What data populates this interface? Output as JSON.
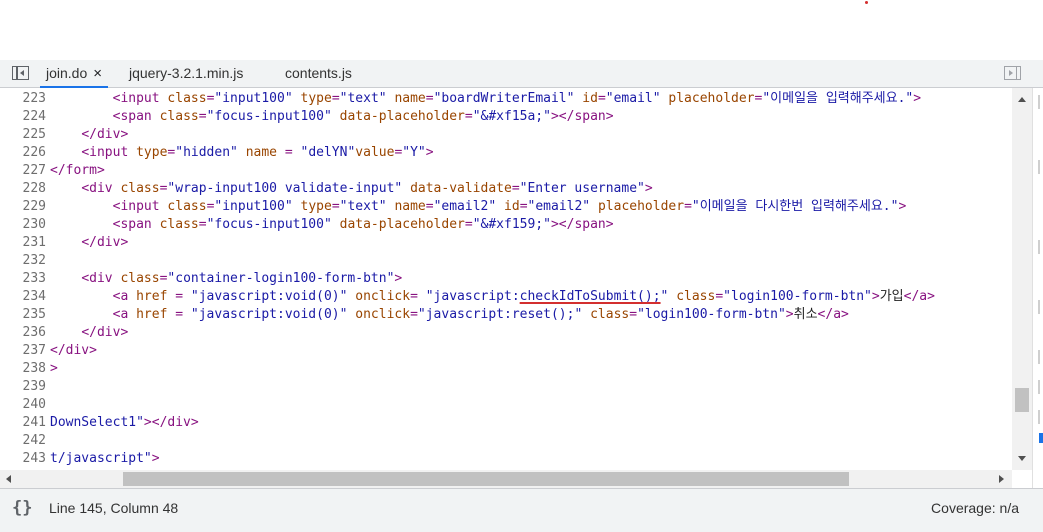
{
  "tabs": [
    {
      "label": "join.do",
      "active": true,
      "close": "×"
    },
    {
      "label": "jquery-3.2.1.min.js",
      "active": false
    },
    {
      "label": "contents.js",
      "active": false
    }
  ],
  "lines": [
    {
      "n": "223",
      "code": [
        [
          "",
          "        "
        ],
        [
          "tag",
          "<input "
        ],
        [
          "attr",
          "class"
        ],
        [
          "tag",
          "="
        ],
        [
          "val",
          "\"input100\""
        ],
        [
          "",
          " "
        ],
        [
          "attr",
          "type"
        ],
        [
          "tag",
          "="
        ],
        [
          "val",
          "\"text\""
        ],
        [
          "",
          " "
        ],
        [
          "attr",
          "name"
        ],
        [
          "tag",
          "="
        ],
        [
          "val",
          "\"boardWriterEmail\""
        ],
        [
          "",
          " "
        ],
        [
          "attr",
          "id"
        ],
        [
          "tag",
          "="
        ],
        [
          "val",
          "\"email\""
        ],
        [
          "",
          " "
        ],
        [
          "attr",
          "placeholder"
        ],
        [
          "tag",
          "="
        ],
        [
          "val",
          "\"이메일을 입력해주세요.\""
        ],
        [
          "tag",
          ">"
        ]
      ]
    },
    {
      "n": "224",
      "code": [
        [
          "",
          "        "
        ],
        [
          "tag",
          "<span "
        ],
        [
          "attr",
          "class"
        ],
        [
          "tag",
          "="
        ],
        [
          "val",
          "\"focus-input100\""
        ],
        [
          "",
          " "
        ],
        [
          "attr",
          "data-placeholder"
        ],
        [
          "tag",
          "="
        ],
        [
          "val",
          "\"&#xf15a;\""
        ],
        [
          "tag",
          "></span>"
        ]
      ]
    },
    {
      "n": "225",
      "code": [
        [
          "",
          "    "
        ],
        [
          "tag",
          "</div>"
        ]
      ]
    },
    {
      "n": "226",
      "code": [
        [
          "",
          "    "
        ],
        [
          "tag",
          "<input "
        ],
        [
          "attr",
          "type"
        ],
        [
          "tag",
          "="
        ],
        [
          "val",
          "\"hidden\""
        ],
        [
          "",
          " "
        ],
        [
          "attr",
          "name"
        ],
        [
          "tag",
          " = "
        ],
        [
          "val",
          "\"delYN\""
        ],
        [
          "attr",
          "value"
        ],
        [
          "tag",
          "="
        ],
        [
          "val",
          "\"Y\""
        ],
        [
          "tag",
          ">"
        ]
      ]
    },
    {
      "n": "227",
      "code": [
        [
          "tag",
          "</form>"
        ]
      ]
    },
    {
      "n": "228",
      "code": [
        [
          "",
          "    "
        ],
        [
          "tag",
          "<div "
        ],
        [
          "attr",
          "class"
        ],
        [
          "tag",
          "="
        ],
        [
          "val",
          "\"wrap-input100 validate-input\""
        ],
        [
          "",
          " "
        ],
        [
          "attr",
          "data-validate"
        ],
        [
          "tag",
          "="
        ],
        [
          "val",
          "\"Enter username\""
        ],
        [
          "tag",
          ">"
        ]
      ]
    },
    {
      "n": "229",
      "code": [
        [
          "",
          "        "
        ],
        [
          "tag",
          "<input "
        ],
        [
          "attr",
          "class"
        ],
        [
          "tag",
          "="
        ],
        [
          "val",
          "\"input100\""
        ],
        [
          "",
          " "
        ],
        [
          "attr",
          "type"
        ],
        [
          "tag",
          "="
        ],
        [
          "val",
          "\"text\""
        ],
        [
          "",
          " "
        ],
        [
          "attr",
          "name"
        ],
        [
          "tag",
          "="
        ],
        [
          "val",
          "\"email2\""
        ],
        [
          "",
          " "
        ],
        [
          "attr",
          "id"
        ],
        [
          "tag",
          "="
        ],
        [
          "val",
          "\"email2\""
        ],
        [
          "",
          " "
        ],
        [
          "attr",
          "placeholder"
        ],
        [
          "tag",
          "="
        ],
        [
          "val",
          "\"이메일을 다시한번 입력해주세요.\""
        ],
        [
          "tag",
          ">"
        ]
      ]
    },
    {
      "n": "230",
      "code": [
        [
          "",
          "        "
        ],
        [
          "tag",
          "<span "
        ],
        [
          "attr",
          "class"
        ],
        [
          "tag",
          "="
        ],
        [
          "val",
          "\"focus-input100\""
        ],
        [
          "",
          " "
        ],
        [
          "attr",
          "data-placeholder"
        ],
        [
          "tag",
          "="
        ],
        [
          "val",
          "\"&#xf159;\""
        ],
        [
          "tag",
          "></span>"
        ]
      ]
    },
    {
      "n": "231",
      "code": [
        [
          "",
          "    "
        ],
        [
          "tag",
          "</div>"
        ]
      ]
    },
    {
      "n": "232",
      "code": []
    },
    {
      "n": "233",
      "code": [
        [
          "",
          "    "
        ],
        [
          "tag",
          "<div "
        ],
        [
          "attr",
          "class"
        ],
        [
          "tag",
          "="
        ],
        [
          "val",
          "\"container-login100-form-btn\""
        ],
        [
          "tag",
          ">"
        ]
      ]
    },
    {
      "n": "234",
      "code": [
        [
          "",
          "        "
        ],
        [
          "tag",
          "<a "
        ],
        [
          "attr",
          "href"
        ],
        [
          "tag",
          " = "
        ],
        [
          "val",
          "\"javascript:void(0)\""
        ],
        [
          "",
          " "
        ],
        [
          "attr",
          "onclick"
        ],
        [
          "tag",
          "= "
        ],
        [
          "val",
          "\"javascript:"
        ],
        [
          "valsq",
          "checkIdToSubmit();"
        ],
        [
          "val",
          "\""
        ],
        [
          "",
          " "
        ],
        [
          "attr",
          "class"
        ],
        [
          "tag",
          "="
        ],
        [
          "val",
          "\"login100-form-btn\""
        ],
        [
          "tag",
          ">"
        ],
        [
          "text",
          "가입"
        ],
        [
          "tag",
          "</a>"
        ]
      ]
    },
    {
      "n": "235",
      "code": [
        [
          "",
          "        "
        ],
        [
          "tag",
          "<a "
        ],
        [
          "attr",
          "href"
        ],
        [
          "tag",
          " = "
        ],
        [
          "val",
          "\"javascript:void(0)\""
        ],
        [
          "",
          " "
        ],
        [
          "attr",
          "onclick"
        ],
        [
          "tag",
          "="
        ],
        [
          "val",
          "\"javascript:reset();\""
        ],
        [
          "",
          " "
        ],
        [
          "attr",
          "class"
        ],
        [
          "tag",
          "="
        ],
        [
          "val",
          "\"login100-form-btn\""
        ],
        [
          "tag",
          ">"
        ],
        [
          "text",
          "취소"
        ],
        [
          "tag",
          "</a>"
        ]
      ]
    },
    {
      "n": "236",
      "code": [
        [
          "",
          "    "
        ],
        [
          "tag",
          "</div>"
        ]
      ]
    },
    {
      "n": "237",
      "code": [
        [
          "tag",
          "</div>"
        ]
      ]
    },
    {
      "n": "238",
      "code": [
        [
          "tag",
          ">"
        ]
      ]
    },
    {
      "n": "239",
      "code": []
    },
    {
      "n": "240",
      "code": []
    },
    {
      "n": "241",
      "code": [
        [
          "val",
          "DownSelect1\""
        ],
        [
          "tag",
          "></div>"
        ]
      ]
    },
    {
      "n": "242",
      "code": []
    },
    {
      "n": "243",
      "code": [
        [
          "val",
          "t/javascript\""
        ],
        [
          "tag",
          ">"
        ]
      ]
    }
  ],
  "status": {
    "pretty_print": "{}",
    "cursor": "Line 145, Column 48",
    "coverage": "Coverage: n/a"
  },
  "colors": {
    "tag": "#881280",
    "attr": "#994500",
    "value": "#1a1aa6",
    "active_tab_underline": "#1a73e8"
  },
  "icons": [
    "navigator-toggle-icon",
    "close-icon",
    "panel-toggle-icon",
    "pretty-print-icon"
  ]
}
